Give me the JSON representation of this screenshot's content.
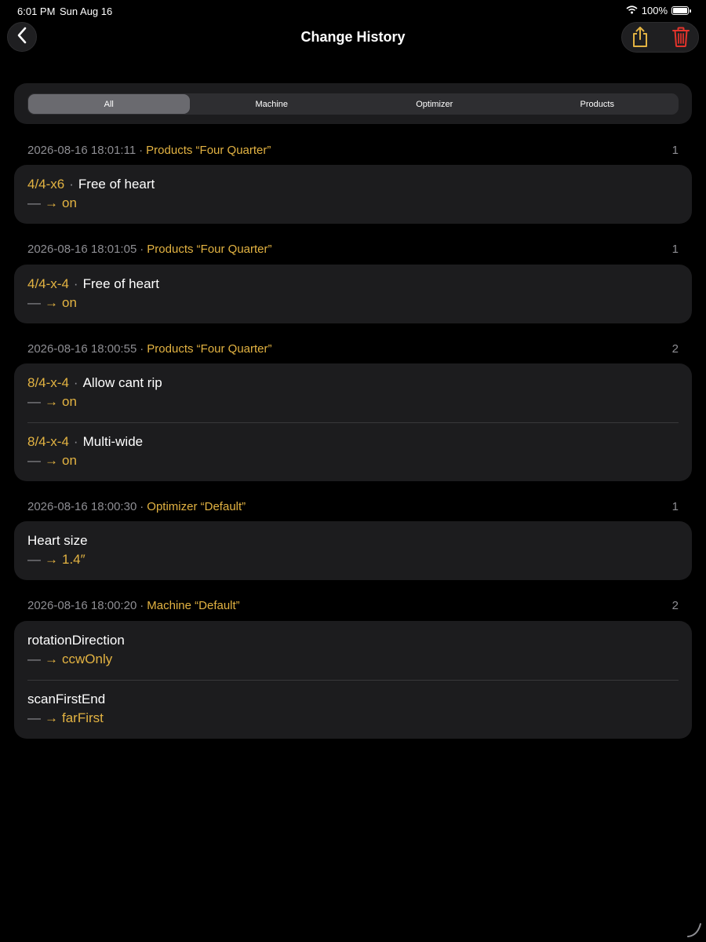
{
  "status_bar": {
    "time": "6:01 PM",
    "date": "Sun Aug 16",
    "battery": "100%"
  },
  "nav": {
    "title": "Change History",
    "back_icon": "chevron-left-icon",
    "share_icon": "share-icon",
    "trash_icon": "trash-icon"
  },
  "colors": {
    "accent": "#e3b342",
    "destructive": "#e5342c",
    "card": "#1c1c1e",
    "secondary_text": "#8e8e93"
  },
  "segments": [
    {
      "label": "All",
      "selected": true
    },
    {
      "label": "Machine",
      "selected": false
    },
    {
      "label": "Optimizer",
      "selected": false
    },
    {
      "label": "Products",
      "selected": false
    }
  ],
  "groups": [
    {
      "timestamp": "2026-08-16 18:01:11",
      "separator": "·",
      "target": "Products “Four Quarter”",
      "count": "1",
      "rows": [
        {
          "size": "4/4-x6",
          "sep": "·",
          "field": "Free of heart",
          "old": "—",
          "arrow": "→",
          "new": "on"
        }
      ]
    },
    {
      "timestamp": "2026-08-16 18:01:05",
      "separator": "·",
      "target": "Products “Four Quarter”",
      "count": "1",
      "rows": [
        {
          "size": "4/4-x-4",
          "sep": "·",
          "field": "Free of heart",
          "old": "—",
          "arrow": "→",
          "new": "on"
        }
      ]
    },
    {
      "timestamp": "2026-08-16 18:00:55",
      "separator": "·",
      "target": "Products “Four Quarter”",
      "count": "2",
      "rows": [
        {
          "size": "8/4-x-4",
          "sep": "·",
          "field": "Allow cant rip",
          "old": "—",
          "arrow": "→",
          "new": "on"
        },
        {
          "size": "8/4-x-4",
          "sep": "·",
          "field": "Multi-wide",
          "old": "—",
          "arrow": "→",
          "new": "on"
        }
      ]
    },
    {
      "timestamp": "2026-08-16 18:00:30",
      "separator": "·",
      "target": "Optimizer “Default”",
      "count": "1",
      "rows": [
        {
          "field": "Heart size",
          "old": "—",
          "arrow": "→",
          "new": "1.4″"
        }
      ]
    },
    {
      "timestamp": "2026-08-16 18:00:20",
      "separator": "·",
      "target": "Machine “Default”",
      "count": "2",
      "rows": [
        {
          "field": "rotationDirection",
          "old": "—",
          "arrow": "→",
          "new": "ccwOnly"
        },
        {
          "field": "scanFirstEnd",
          "old": "—",
          "arrow": "→",
          "new": "farFirst"
        }
      ]
    }
  ]
}
